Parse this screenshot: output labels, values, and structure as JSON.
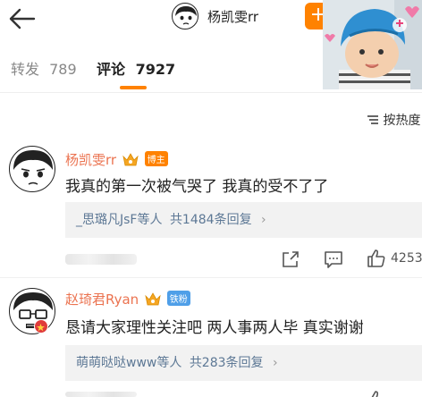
{
  "header": {
    "back_icon": "arrow-left-icon",
    "title": "杨凯雯rr",
    "follow_icon": "plus-icon",
    "accent": "#ff8200"
  },
  "tabs": {
    "repost_label": "转发",
    "repost_count": "789",
    "comment_label": "评论",
    "comment_count": "7927"
  },
  "sort": {
    "label": "按热度"
  },
  "comments": [
    {
      "name": "杨凯雯rr",
      "badge": "博主",
      "text": "我真的第一次被气哭了 我真的受不了了",
      "replies_users": "_思璐凡JsF等人",
      "replies_count": "共1484条回复",
      "likes": "4253"
    },
    {
      "name": "赵琦君Ryan",
      "badge": "铁粉",
      "text": "恳请大家理性关注吧 两人事两人毕 真实谢谢",
      "replies_users": "萌萌哒哒www等人",
      "replies_count": "共283条回复"
    }
  ],
  "colors": {
    "name": "#eb7350",
    "link": "#5d7895",
    "reply_bg": "#f2f2f2"
  }
}
